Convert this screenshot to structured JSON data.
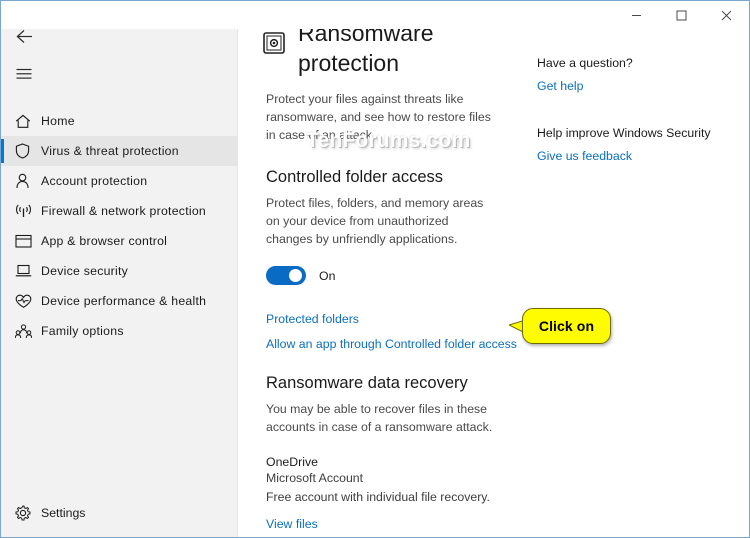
{
  "window": {
    "controls": [
      {
        "name": "minimize",
        "glyph": "minimize-icon"
      },
      {
        "name": "maximize",
        "glyph": "maximize-icon"
      },
      {
        "name": "close",
        "glyph": "close-icon"
      }
    ]
  },
  "sidebar": {
    "back_icon": "back-arrow-icon",
    "menu_icon": "hamburger-menu-icon",
    "items": [
      {
        "label": "Home",
        "icon": "home-icon",
        "selected": false
      },
      {
        "label": "Virus & threat protection",
        "icon": "shield-icon",
        "selected": true
      },
      {
        "label": "Account protection",
        "icon": "person-icon",
        "selected": false
      },
      {
        "label": "Firewall & network protection",
        "icon": "wifi-signal-icon",
        "selected": false
      },
      {
        "label": "App & browser control",
        "icon": "browser-window-icon",
        "selected": false
      },
      {
        "label": "Device security",
        "icon": "laptop-icon",
        "selected": false
      },
      {
        "label": "Device performance & health",
        "icon": "heart-pulse-icon",
        "selected": false
      },
      {
        "label": "Family options",
        "icon": "family-group-icon",
        "selected": false
      }
    ],
    "settings": {
      "label": "Settings",
      "icon": "gear-icon"
    }
  },
  "main": {
    "page_icon": "ransomware-protection-icon",
    "title": "Ransomware protection",
    "description": "Protect your files against threats like ransomware, and see how to restore files in case of an attack.",
    "controlled_folder_access": {
      "heading": "Controlled folder access",
      "description": "Protect files, folders, and memory areas on your device from unauthorized changes by unfriendly applications.",
      "toggle_state": "On",
      "toggle_on": true,
      "links": [
        "Protected folders",
        "Allow an app through Controlled folder access"
      ]
    },
    "data_recovery": {
      "heading": "Ransomware data recovery",
      "description": "You may be able to recover files in these accounts in case of a ransomware attack.",
      "account_name": "OneDrive",
      "account_type": "Microsoft Account",
      "account_detail": "Free account with individual file recovery.",
      "link": "View files"
    }
  },
  "help": {
    "question_heading": "Have a question?",
    "question_link": "Get help",
    "improve_heading": "Help improve Windows Security",
    "improve_link": "Give us feedback"
  },
  "annotation": {
    "callout_text": "Click on",
    "callout_bg": "#fffb00"
  },
  "watermark": {
    "text": "TenForums.com"
  },
  "colors": {
    "accent": "#0078d7",
    "link": "#0b6fbf",
    "toggle_on": "#0a6bc4",
    "sidebar_bg": "#f2f2f2"
  }
}
